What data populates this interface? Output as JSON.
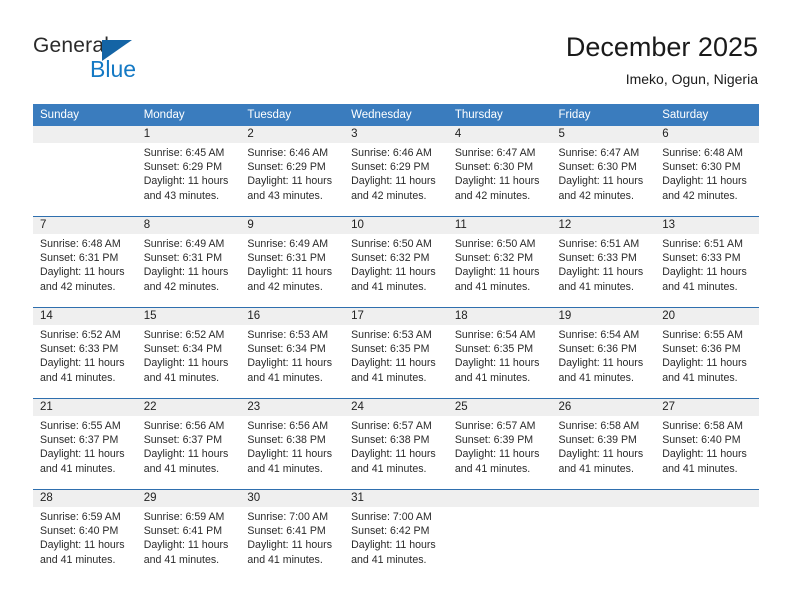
{
  "brand": {
    "name_part1": "General",
    "name_part2": "Blue",
    "flag_icon": "triangle-flag-icon",
    "colors": {
      "blue": "#1479c4",
      "flag_blue": "#1464a5",
      "dark": "#2b2b2b"
    }
  },
  "header": {
    "title": "December 2025",
    "subtitle": "Imeko, Ogun, Nigeria"
  },
  "theme": {
    "header_bar": "#3a7cbe",
    "row_divider": "#2f6fae",
    "daynum_band": "#efefef",
    "text": "#2a2a2a"
  },
  "weekdays": [
    "Sunday",
    "Monday",
    "Tuesday",
    "Wednesday",
    "Thursday",
    "Friday",
    "Saturday"
  ],
  "labels": {
    "sunrise": "Sunrise:",
    "sunset": "Sunset:",
    "daylight": "Daylight:"
  },
  "weeks": [
    [
      {
        "day": "",
        "blank": true,
        "sunrise": "",
        "sunset": "",
        "daylight_line1": "",
        "daylight_line2": ""
      },
      {
        "day": "1",
        "blank": false,
        "sunrise": "Sunrise: 6:45 AM",
        "sunset": "Sunset: 6:29 PM",
        "daylight_line1": "Daylight: 11 hours",
        "daylight_line2": "and 43 minutes."
      },
      {
        "day": "2",
        "blank": false,
        "sunrise": "Sunrise: 6:46 AM",
        "sunset": "Sunset: 6:29 PM",
        "daylight_line1": "Daylight: 11 hours",
        "daylight_line2": "and 43 minutes."
      },
      {
        "day": "3",
        "blank": false,
        "sunrise": "Sunrise: 6:46 AM",
        "sunset": "Sunset: 6:29 PM",
        "daylight_line1": "Daylight: 11 hours",
        "daylight_line2": "and 42 minutes."
      },
      {
        "day": "4",
        "blank": false,
        "sunrise": "Sunrise: 6:47 AM",
        "sunset": "Sunset: 6:30 PM",
        "daylight_line1": "Daylight: 11 hours",
        "daylight_line2": "and 42 minutes."
      },
      {
        "day": "5",
        "blank": false,
        "sunrise": "Sunrise: 6:47 AM",
        "sunset": "Sunset: 6:30 PM",
        "daylight_line1": "Daylight: 11 hours",
        "daylight_line2": "and 42 minutes."
      },
      {
        "day": "6",
        "blank": false,
        "sunrise": "Sunrise: 6:48 AM",
        "sunset": "Sunset: 6:30 PM",
        "daylight_line1": "Daylight: 11 hours",
        "daylight_line2": "and 42 minutes."
      }
    ],
    [
      {
        "day": "7",
        "blank": false,
        "sunrise": "Sunrise: 6:48 AM",
        "sunset": "Sunset: 6:31 PM",
        "daylight_line1": "Daylight: 11 hours",
        "daylight_line2": "and 42 minutes."
      },
      {
        "day": "8",
        "blank": false,
        "sunrise": "Sunrise: 6:49 AM",
        "sunset": "Sunset: 6:31 PM",
        "daylight_line1": "Daylight: 11 hours",
        "daylight_line2": "and 42 minutes."
      },
      {
        "day": "9",
        "blank": false,
        "sunrise": "Sunrise: 6:49 AM",
        "sunset": "Sunset: 6:31 PM",
        "daylight_line1": "Daylight: 11 hours",
        "daylight_line2": "and 42 minutes."
      },
      {
        "day": "10",
        "blank": false,
        "sunrise": "Sunrise: 6:50 AM",
        "sunset": "Sunset: 6:32 PM",
        "daylight_line1": "Daylight: 11 hours",
        "daylight_line2": "and 41 minutes."
      },
      {
        "day": "11",
        "blank": false,
        "sunrise": "Sunrise: 6:50 AM",
        "sunset": "Sunset: 6:32 PM",
        "daylight_line1": "Daylight: 11 hours",
        "daylight_line2": "and 41 minutes."
      },
      {
        "day": "12",
        "blank": false,
        "sunrise": "Sunrise: 6:51 AM",
        "sunset": "Sunset: 6:33 PM",
        "daylight_line1": "Daylight: 11 hours",
        "daylight_line2": "and 41 minutes."
      },
      {
        "day": "13",
        "blank": false,
        "sunrise": "Sunrise: 6:51 AM",
        "sunset": "Sunset: 6:33 PM",
        "daylight_line1": "Daylight: 11 hours",
        "daylight_line2": "and 41 minutes."
      }
    ],
    [
      {
        "day": "14",
        "blank": false,
        "sunrise": "Sunrise: 6:52 AM",
        "sunset": "Sunset: 6:33 PM",
        "daylight_line1": "Daylight: 11 hours",
        "daylight_line2": "and 41 minutes."
      },
      {
        "day": "15",
        "blank": false,
        "sunrise": "Sunrise: 6:52 AM",
        "sunset": "Sunset: 6:34 PM",
        "daylight_line1": "Daylight: 11 hours",
        "daylight_line2": "and 41 minutes."
      },
      {
        "day": "16",
        "blank": false,
        "sunrise": "Sunrise: 6:53 AM",
        "sunset": "Sunset: 6:34 PM",
        "daylight_line1": "Daylight: 11 hours",
        "daylight_line2": "and 41 minutes."
      },
      {
        "day": "17",
        "blank": false,
        "sunrise": "Sunrise: 6:53 AM",
        "sunset": "Sunset: 6:35 PM",
        "daylight_line1": "Daylight: 11 hours",
        "daylight_line2": "and 41 minutes."
      },
      {
        "day": "18",
        "blank": false,
        "sunrise": "Sunrise: 6:54 AM",
        "sunset": "Sunset: 6:35 PM",
        "daylight_line1": "Daylight: 11 hours",
        "daylight_line2": "and 41 minutes."
      },
      {
        "day": "19",
        "blank": false,
        "sunrise": "Sunrise: 6:54 AM",
        "sunset": "Sunset: 6:36 PM",
        "daylight_line1": "Daylight: 11 hours",
        "daylight_line2": "and 41 minutes."
      },
      {
        "day": "20",
        "blank": false,
        "sunrise": "Sunrise: 6:55 AM",
        "sunset": "Sunset: 6:36 PM",
        "daylight_line1": "Daylight: 11 hours",
        "daylight_line2": "and 41 minutes."
      }
    ],
    [
      {
        "day": "21",
        "blank": false,
        "sunrise": "Sunrise: 6:55 AM",
        "sunset": "Sunset: 6:37 PM",
        "daylight_line1": "Daylight: 11 hours",
        "daylight_line2": "and 41 minutes."
      },
      {
        "day": "22",
        "blank": false,
        "sunrise": "Sunrise: 6:56 AM",
        "sunset": "Sunset: 6:37 PM",
        "daylight_line1": "Daylight: 11 hours",
        "daylight_line2": "and 41 minutes."
      },
      {
        "day": "23",
        "blank": false,
        "sunrise": "Sunrise: 6:56 AM",
        "sunset": "Sunset: 6:38 PM",
        "daylight_line1": "Daylight: 11 hours",
        "daylight_line2": "and 41 minutes."
      },
      {
        "day": "24",
        "blank": false,
        "sunrise": "Sunrise: 6:57 AM",
        "sunset": "Sunset: 6:38 PM",
        "daylight_line1": "Daylight: 11 hours",
        "daylight_line2": "and 41 minutes."
      },
      {
        "day": "25",
        "blank": false,
        "sunrise": "Sunrise: 6:57 AM",
        "sunset": "Sunset: 6:39 PM",
        "daylight_line1": "Daylight: 11 hours",
        "daylight_line2": "and 41 minutes."
      },
      {
        "day": "26",
        "blank": false,
        "sunrise": "Sunrise: 6:58 AM",
        "sunset": "Sunset: 6:39 PM",
        "daylight_line1": "Daylight: 11 hours",
        "daylight_line2": "and 41 minutes."
      },
      {
        "day": "27",
        "blank": false,
        "sunrise": "Sunrise: 6:58 AM",
        "sunset": "Sunset: 6:40 PM",
        "daylight_line1": "Daylight: 11 hours",
        "daylight_line2": "and 41 minutes."
      }
    ],
    [
      {
        "day": "28",
        "blank": false,
        "sunrise": "Sunrise: 6:59 AM",
        "sunset": "Sunset: 6:40 PM",
        "daylight_line1": "Daylight: 11 hours",
        "daylight_line2": "and 41 minutes."
      },
      {
        "day": "29",
        "blank": false,
        "sunrise": "Sunrise: 6:59 AM",
        "sunset": "Sunset: 6:41 PM",
        "daylight_line1": "Daylight: 11 hours",
        "daylight_line2": "and 41 minutes."
      },
      {
        "day": "30",
        "blank": false,
        "sunrise": "Sunrise: 7:00 AM",
        "sunset": "Sunset: 6:41 PM",
        "daylight_line1": "Daylight: 11 hours",
        "daylight_line2": "and 41 minutes."
      },
      {
        "day": "31",
        "blank": false,
        "sunrise": "Sunrise: 7:00 AM",
        "sunset": "Sunset: 6:42 PM",
        "daylight_line1": "Daylight: 11 hours",
        "daylight_line2": "and 41 minutes."
      },
      {
        "day": "",
        "blank": true,
        "sunrise": "",
        "sunset": "",
        "daylight_line1": "",
        "daylight_line2": ""
      },
      {
        "day": "",
        "blank": true,
        "sunrise": "",
        "sunset": "",
        "daylight_line1": "",
        "daylight_line2": ""
      },
      {
        "day": "",
        "blank": true,
        "sunrise": "",
        "sunset": "",
        "daylight_line1": "",
        "daylight_line2": ""
      }
    ]
  ]
}
